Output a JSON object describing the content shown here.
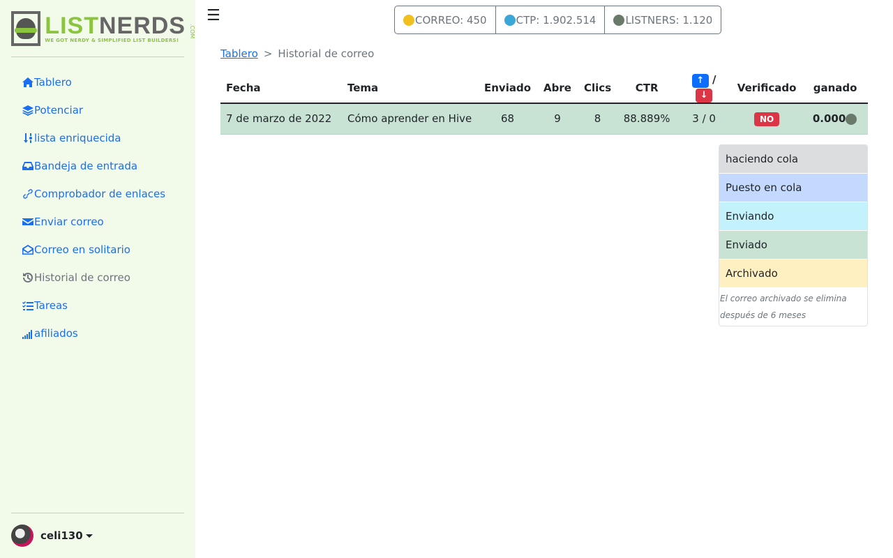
{
  "logo": {
    "main_green": "LIST",
    "main_gray": "NERDS",
    "com": ".COM",
    "tagline": "WE GOT NERDY & SIMPLIFIED LIST BUILDERS!"
  },
  "sidebar": {
    "items": [
      {
        "label": "Tablero",
        "icon": "home-icon"
      },
      {
        "label": "Potenciar",
        "icon": "layers-icon"
      },
      {
        "label": "lista enriquecida",
        "icon": "sort-icon"
      },
      {
        "label": "Bandeja de entrada",
        "icon": "inbox-icon"
      },
      {
        "label": "Comprobador de enlaces",
        "icon": "link-icon"
      },
      {
        "label": "Enviar correo",
        "icon": "envelope-icon"
      },
      {
        "label": "Correo en solitario",
        "icon": "envelope-open-icon"
      },
      {
        "label": "Historial de correo",
        "icon": "history-icon"
      },
      {
        "label": "Tareas",
        "icon": "tasks-icon"
      },
      {
        "label": "afiliados",
        "icon": "signal-icon"
      }
    ],
    "user": "celi130"
  },
  "header": {
    "menu_icon": "☰",
    "stats": [
      "CORREO: 450",
      "CTP: 1.902.514",
      "LISTNERS: 1.120"
    ]
  },
  "breadcrumb": {
    "home": "Tablero",
    "sep": ">",
    "current": "Historial de correo"
  },
  "table": {
    "headers": [
      "Fecha",
      "Tema",
      "Enviado",
      "Abre",
      "Clics",
      "CTR",
      "/",
      "Verificado",
      "ganado"
    ],
    "up": "↑",
    "down": "↓",
    "rows": [
      {
        "fecha": "7 de marzo de 2022",
        "tema": "Cómo aprender en Hive",
        "enviado": "68",
        "abre": "9",
        "clics": "8",
        "ctr": "88.889%",
        "updown": "3 / 0",
        "verificado": "NO",
        "ganado": "0.000"
      }
    ]
  },
  "legend": {
    "items": [
      "haciendo cola",
      "Puesto en cola",
      "Enviando",
      "Enviado",
      "Archivado"
    ],
    "colors": [
      "#dcdddf",
      "#c3d9fd",
      "#c4f2fc",
      "#c8e3d4",
      "#fff0c2"
    ],
    "note": "El correo archivado se elimina después de 6 meses"
  },
  "colors": {
    "link": "#1a6ef0",
    "up": "#0d6efd",
    "down": "#dc3545"
  }
}
